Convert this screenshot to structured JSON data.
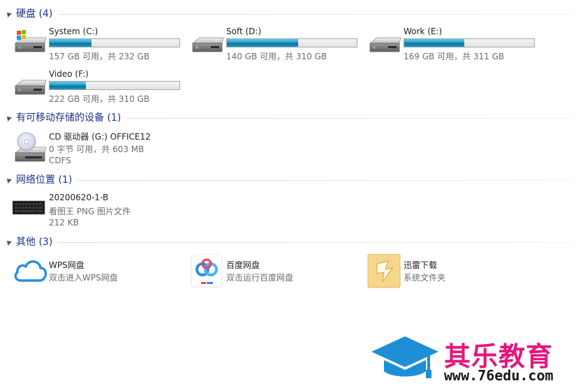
{
  "groups": {
    "hard_drives": {
      "title": "硬盘 (4)"
    },
    "removable": {
      "title": "有可移动存储的设备 (1)"
    },
    "network": {
      "title": "网络位置 (1)"
    },
    "other": {
      "title": "其他 (3)"
    }
  },
  "drives": [
    {
      "name": "System (C:)",
      "info": "157 GB 可用，共 232 GB",
      "used_fraction": 0.32,
      "icon": "windows-drive-icon"
    },
    {
      "name": "Soft (D:)",
      "info": "140 GB 可用，共 310 GB",
      "used_fraction": 0.55,
      "icon": "hard-drive-icon"
    },
    {
      "name": "Work (E:)",
      "info": "169 GB 可用，共 311 GB",
      "used_fraction": 0.46,
      "icon": "hard-drive-icon"
    },
    {
      "name": "Video (F:)",
      "info": "222 GB 可用，共 310 GB",
      "used_fraction": 0.28,
      "icon": "hard-drive-icon"
    }
  ],
  "removable_devices": [
    {
      "name": "CD 驱动器 (G:) OFFICE12",
      "info": "0 字节 可用，共 603 MB",
      "fs": "CDFS",
      "icon": "cd-drive-icon"
    }
  ],
  "network_items": [
    {
      "name": "20200620-1-B",
      "type": "看图王 PNG 图片文件",
      "size": "212 KB",
      "icon": "png-thumbnail-icon"
    }
  ],
  "other_items": [
    {
      "name": "WPS网盘",
      "desc": "双击进入WPS网盘",
      "icon": "wps-cloud-icon"
    },
    {
      "name": "百度网盘",
      "desc": "双击运行百度网盘",
      "icon": "baidu-netdisk-icon"
    },
    {
      "name": "迅雷下载",
      "desc": "系统文件夹",
      "icon": "thunder-folder-icon"
    }
  ],
  "watermark": {
    "brand": "其乐教育",
    "url": "www.76edu.com",
    "icon": "graduation-cap-icon"
  },
  "colors": {
    "group_title": "#1e3287",
    "bar_fill": "#26a0d0",
    "brand": "#e3177b",
    "cap": "#1e8fd6"
  }
}
